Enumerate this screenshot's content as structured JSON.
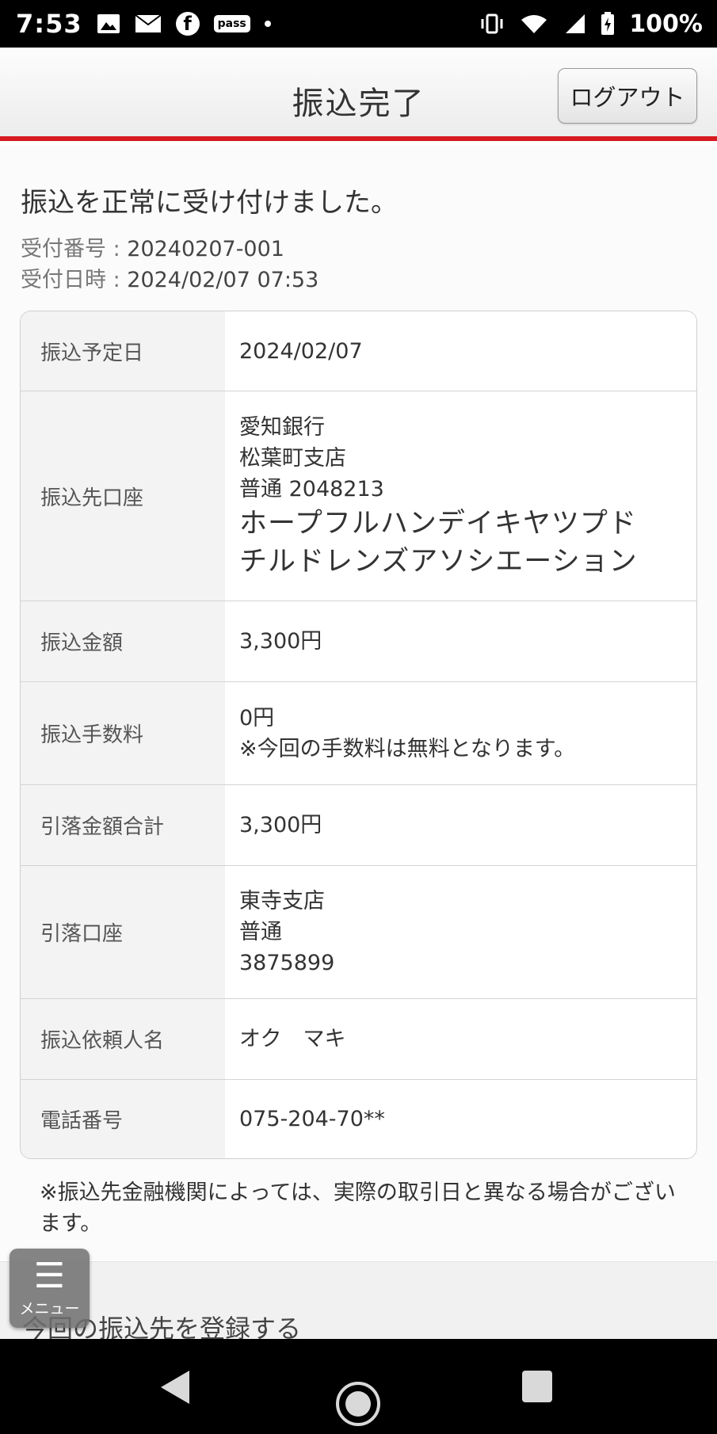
{
  "status_bar": {
    "time": "7:53",
    "pass_label": "pass",
    "battery": "100%",
    "icons": [
      "image-icon",
      "mail-icon",
      "facebook-icon",
      "pass-icon",
      "dot-icon",
      "vibrate-icon",
      "wifi-icon",
      "signal-icon",
      "battery-icon"
    ]
  },
  "header": {
    "title": "振込完了",
    "logout_label": "ログアウト",
    "accent_color": "#d71920"
  },
  "receipt": {
    "message": "振込を正常に受け付けました。",
    "number_label": "受付番号 : ",
    "number": "20240207-001",
    "datetime_label": "受付日時 : ",
    "datetime": "2024/02/07 07:53"
  },
  "details": {
    "scheduled_date": {
      "label": "振込予定日",
      "value": "2024/02/07"
    },
    "payee": {
      "label": "振込先口座",
      "bank": "愛知銀行",
      "branch": "松葉町支店",
      "account": "普通 2048213",
      "name_line1": "ホープフルハンデイキヤツプド",
      "name_line2": "チルドレンズアソシエーション"
    },
    "amount": {
      "label": "振込金額",
      "value": "3,300円"
    },
    "fee": {
      "label": "振込手数料",
      "value": "0円",
      "note": "※今回の手数料は無料となります。"
    },
    "total": {
      "label": "引落金額合計",
      "value": "3,300円"
    },
    "debit_account": {
      "label": "引落口座",
      "branch": "東寺支店",
      "type": "普通",
      "number": "3875899"
    },
    "requester": {
      "label": "振込依頼人名",
      "value": "オク　マキ"
    },
    "phone": {
      "label": "電話番号",
      "value": "075-204-70**"
    }
  },
  "note": "※振込先金融機関によっては、実際の取引日と異なる場合がございます。",
  "register_label": "今回の振込先を登録する",
  "menu": {
    "icon": "☰",
    "label": "メニュー"
  }
}
